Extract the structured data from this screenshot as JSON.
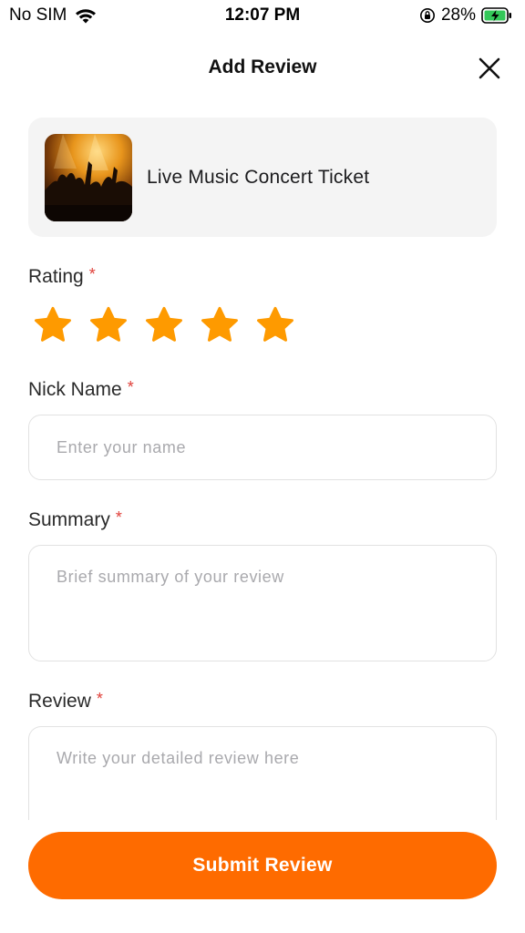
{
  "status_bar": {
    "carrier": "No SIM",
    "time": "12:07 PM",
    "battery_percent": "28%",
    "icons": [
      "wifi-icon",
      "orientation-lock-icon",
      "battery-charging-icon"
    ]
  },
  "header": {
    "title": "Add Review",
    "close_icon": "close-icon"
  },
  "product": {
    "name": "Live Music Concert Ticket",
    "image": "concert-crowd-thumbnail"
  },
  "rating": {
    "label": "Rating",
    "required_mark": "*",
    "value": 5,
    "max": 5,
    "star_color": "#fe9a00"
  },
  "nickname": {
    "label": "Nick Name",
    "required_mark": "*",
    "placeholder": "Enter your name",
    "value": ""
  },
  "summary": {
    "label": "Summary",
    "required_mark": "*",
    "placeholder": "Brief summary of your review",
    "value": ""
  },
  "review": {
    "label": "Review",
    "required_mark": "*",
    "placeholder": "Write your detailed review here",
    "value": ""
  },
  "submit": {
    "label": "Submit Review",
    "color": "#fe6b00"
  },
  "colors": {
    "accent": "#fe6b00",
    "required": "#e0403a",
    "card_bg": "#f4f4f4",
    "battery_green": "#34c759"
  }
}
